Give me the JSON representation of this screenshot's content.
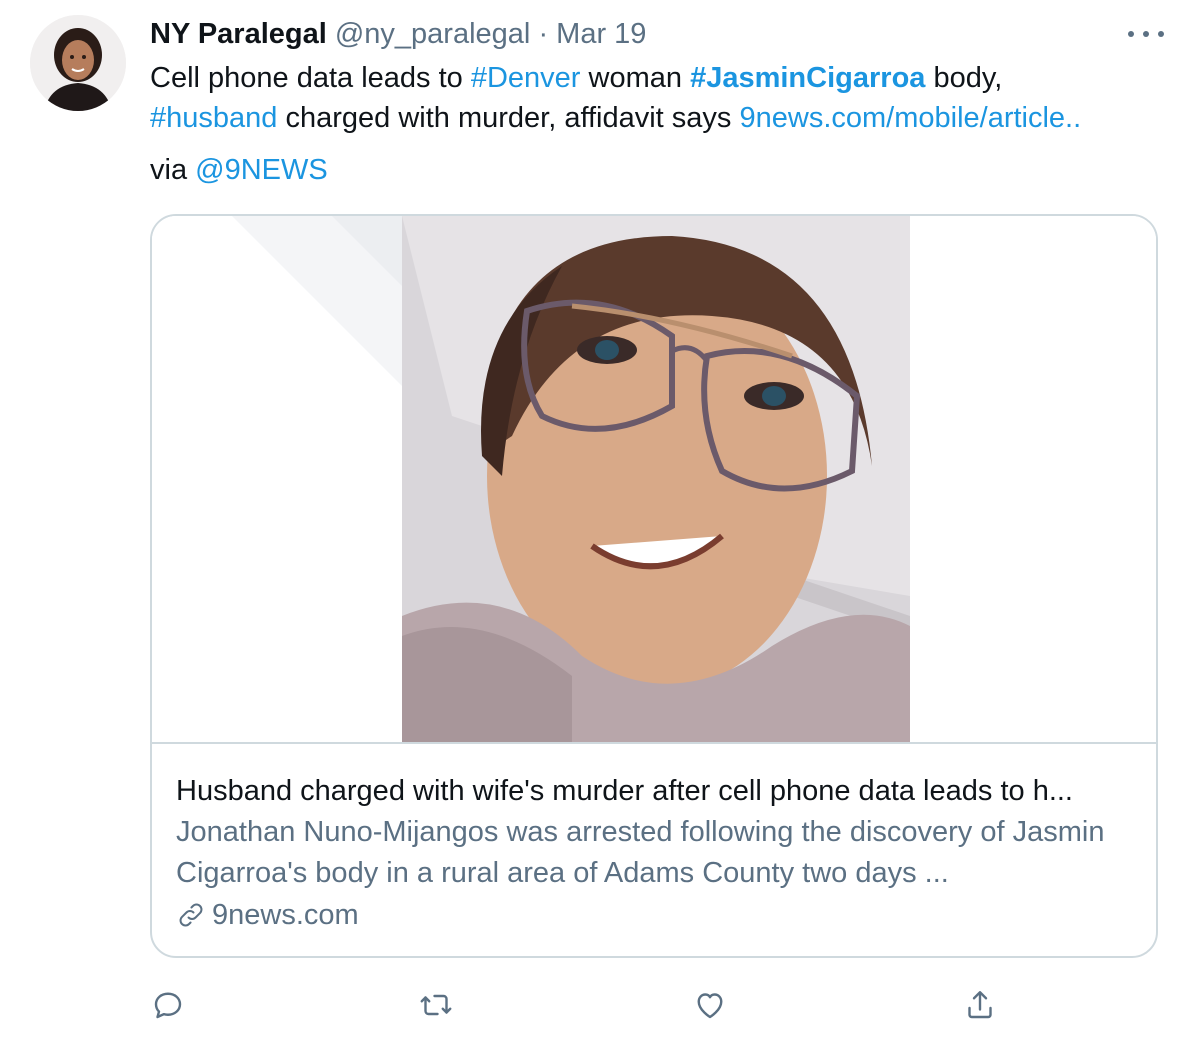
{
  "tweet": {
    "author_name": "NY Paralegal",
    "author_handle": "@ny_paralegal",
    "separator": "·",
    "date": "Mar 19",
    "text": {
      "part1": "Cell phone data leads to ",
      "hashtag_denver": "#Denver",
      "part2": " woman ",
      "hashtag_jasmin": "#JasminCigarroa",
      "part3": " body, ",
      "hashtag_husband": "#husband",
      "part4": " charged with murder, affidavit says ",
      "url": "9news.com/mobile/article.."
    },
    "via_label": "via ",
    "via_handle": "@9NEWS"
  },
  "card": {
    "title": "Husband charged with wife's murder after cell phone data leads to h...",
    "description": "Jonathan Nuno-Mijangos was arrested following the discovery of Jasmin Cigarroa's body in a rural area of Adams County two days ...",
    "domain": "9news.com"
  },
  "icons": {
    "more": "more-icon",
    "reply": "reply-icon",
    "retweet": "retweet-icon",
    "like": "like-icon",
    "share": "share-icon",
    "link": "link-icon"
  },
  "colors": {
    "link": "#1b95e0",
    "secondary": "#5b7083",
    "border": "#cfd9de"
  }
}
